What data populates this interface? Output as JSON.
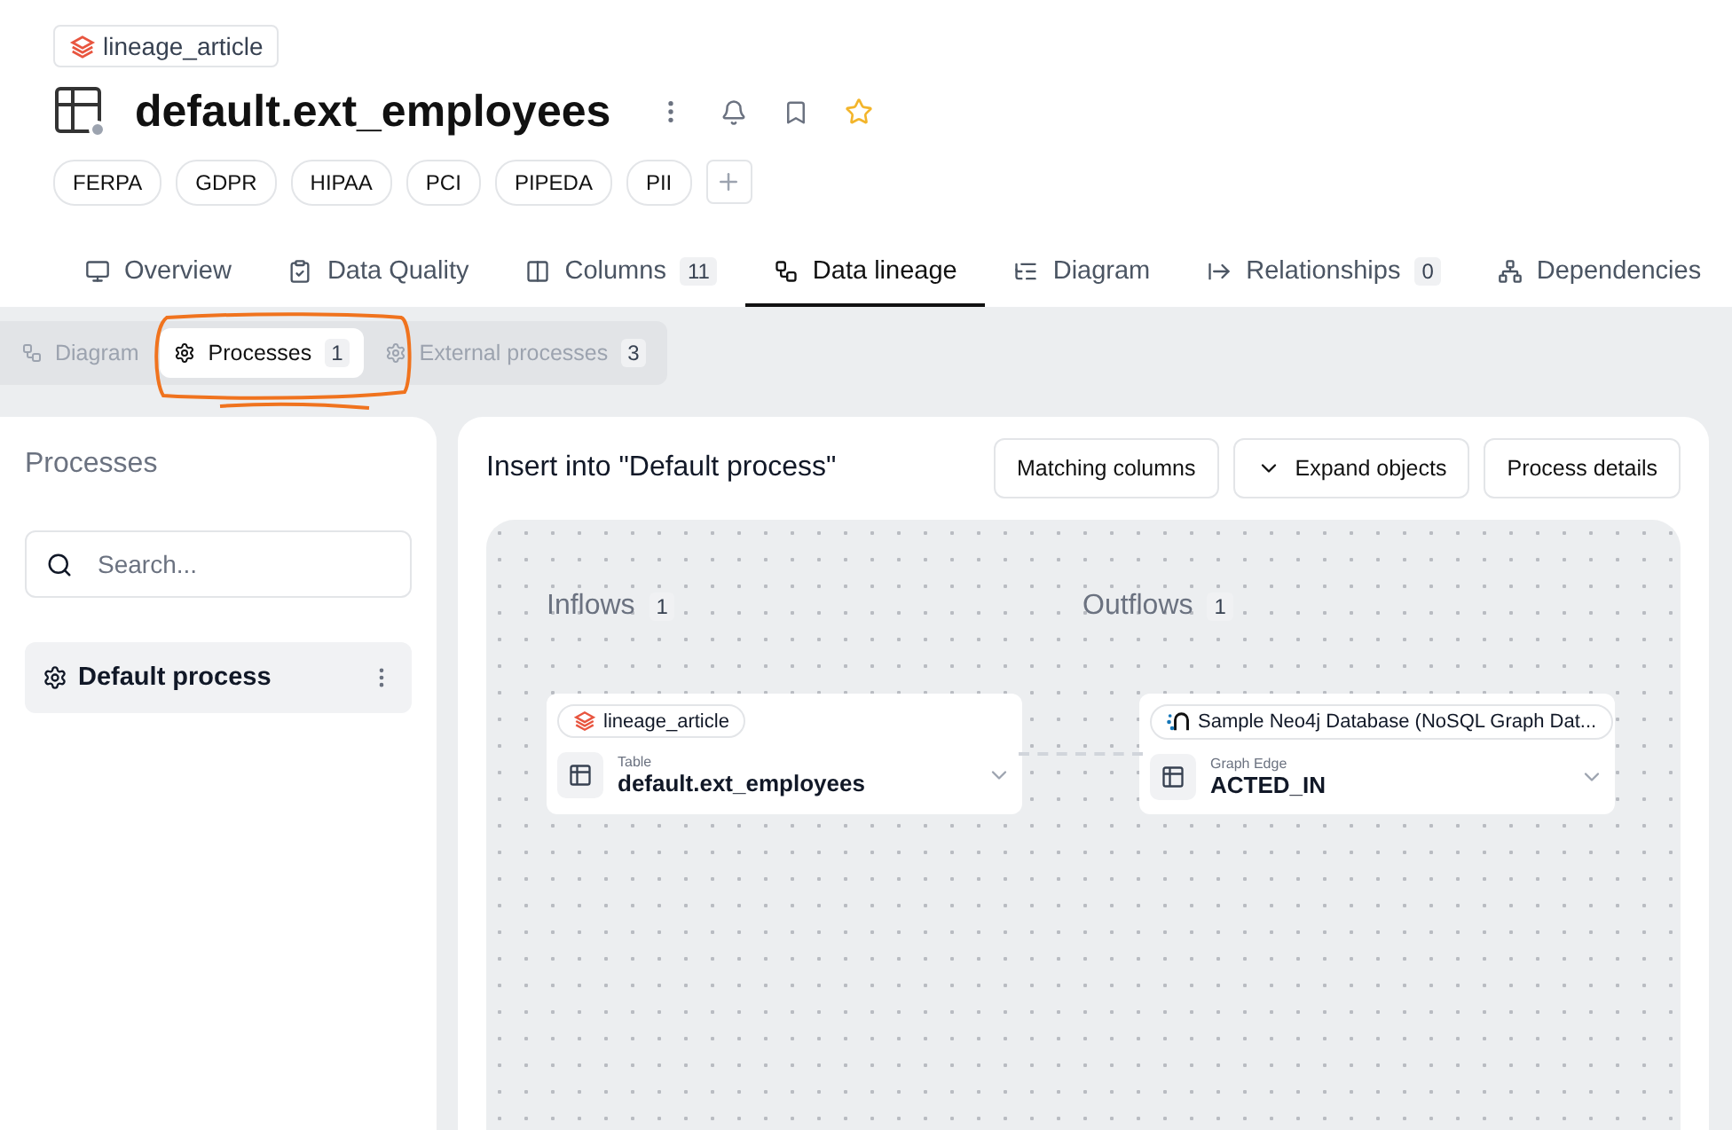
{
  "breadcrumb": {
    "label": "lineage_article"
  },
  "title": "default.ext_employees",
  "tags": [
    "FERPA",
    "GDPR",
    "HIPAA",
    "PCI",
    "PIPEDA",
    "PII"
  ],
  "tabs": [
    {
      "label": "Overview",
      "selected": false
    },
    {
      "label": "Data Quality",
      "selected": false
    },
    {
      "label": "Columns",
      "count": "11",
      "selected": false
    },
    {
      "label": "Data lineage",
      "selected": true
    },
    {
      "label": "Diagram",
      "selected": false
    },
    {
      "label": "Relationships",
      "count": "0",
      "selected": false
    },
    {
      "label": "Dependencies",
      "selected": false
    }
  ],
  "subtabs": [
    {
      "label": "Diagram",
      "selected": false
    },
    {
      "label": "Processes",
      "count": "1",
      "selected": true
    },
    {
      "label": "External processes",
      "count": "3",
      "selected": false
    }
  ],
  "processes_panel": {
    "title": "Processes",
    "search": {
      "placeholder": "Search..."
    },
    "items": [
      {
        "label": "Default process",
        "selected": true
      }
    ]
  },
  "process_view": {
    "title": "Insert into \"Default process\"",
    "buttons": [
      {
        "label": "Matching columns",
        "kind": "plain"
      },
      {
        "label": "Expand objects",
        "kind": "dropdown"
      },
      {
        "label": "Process details",
        "kind": "plain"
      }
    ],
    "flows": [
      {
        "label": "Inflows",
        "count": "1",
        "nodes": [
          {
            "kind": "table",
            "source": "lineage_article",
            "type": "Table",
            "name": "default.ext_employees"
          }
        ]
      },
      {
        "label": "Outflows",
        "count": "1",
        "nodes": [
          {
            "kind": "graph_edge",
            "source": "Sample Neo4j Database (NoSQL Graph Dat...",
            "type": "Graph Edge",
            "name": "ACTED_IN"
          }
        ]
      }
    ]
  }
}
